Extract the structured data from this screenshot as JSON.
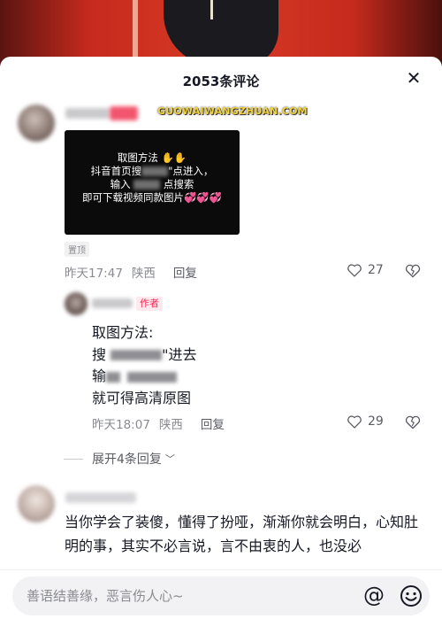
{
  "sheet": {
    "title": "2053条评论",
    "close_glyph": "✕"
  },
  "comment1": {
    "watermark": "GUOWAIWANGZHUAN.COM",
    "image_lines": [
      "取图方法",
      "抖音首页搜",
      "\"点进入，",
      "输入",
      "点搜索",
      "即可下载视频同款图片"
    ],
    "pin_label": "置顶",
    "time": "昨天17:47",
    "location": "陕西",
    "reply_label": "回复",
    "likes": "27"
  },
  "reply1": {
    "author_tag": "作者",
    "lines": [
      "取图方法:",
      "搜",
      "\"进去",
      "输",
      "就可得高清原图"
    ],
    "time": "昨天18:07",
    "location": "陕西",
    "reply_label": "回复",
    "likes": "29"
  },
  "expand": {
    "label": "展开4条回复"
  },
  "comment2": {
    "text": "当你学会了装傻，懂得了扮哑，渐渐你就会明白，心知肚明的事，其实不必言说，言不由衷的人，也没必"
  },
  "input": {
    "placeholder": "善语结善缘，恶言伤人心~",
    "at_glyph": "@"
  },
  "colors": {
    "accent": "#fe2c55",
    "muted": "#8a8b91"
  }
}
